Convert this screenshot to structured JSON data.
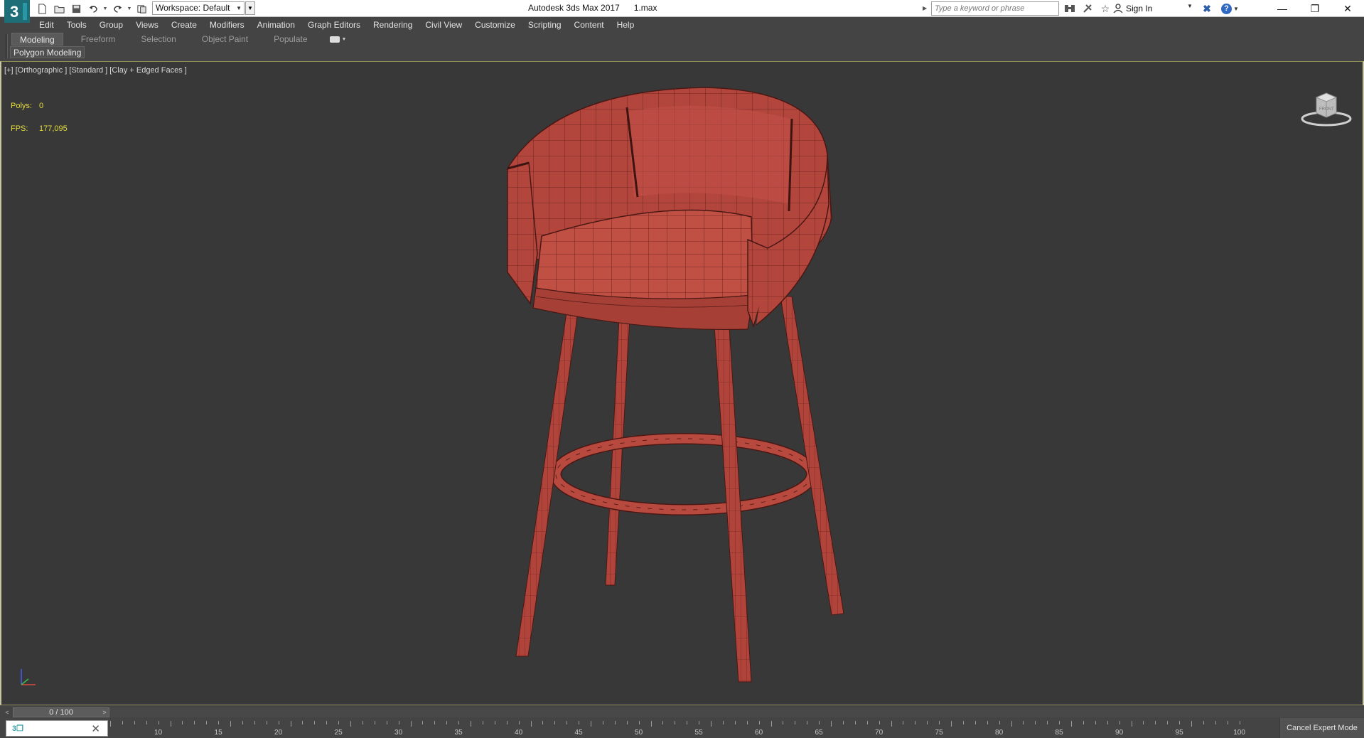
{
  "app": {
    "title": "Autodesk 3ds Max 2017",
    "file": "1.max",
    "workspace": "Workspace: Default",
    "search_placeholder": "Type a keyword or phrase",
    "sign_in": "Sign In"
  },
  "menus": [
    "Edit",
    "Tools",
    "Group",
    "Views",
    "Create",
    "Modifiers",
    "Animation",
    "Graph Editors",
    "Rendering",
    "Civil View",
    "Customize",
    "Scripting",
    "Content",
    "Help"
  ],
  "ribbon": {
    "tabs": [
      "Modeling",
      "Freeform",
      "Selection",
      "Object Paint",
      "Populate"
    ],
    "active_tab": "Modeling",
    "panel": "Polygon Modeling"
  },
  "viewport": {
    "label": "[+] [Orthographic ] [Standard ] [Clay + Edged Faces ]",
    "stats": {
      "polys_label": "Polys:",
      "polys_value": "0",
      "fps_label": "FPS:",
      "fps_value": "177,095"
    },
    "viewcube_face": "FRONT",
    "object_color": "#b8493e",
    "stat_color": "#e6de3c"
  },
  "timeline": {
    "frame": "0 / 100",
    "ticks": [
      "10",
      "15",
      "20",
      "25",
      "30",
      "35",
      "40",
      "45",
      "50",
      "55",
      "60",
      "65",
      "70",
      "75",
      "80",
      "85",
      "90",
      "95",
      "100"
    ]
  },
  "status": {
    "cancel_expert": "Cancel Expert Mode"
  },
  "icons": [
    "new-file-icon",
    "open-file-icon",
    "save-icon",
    "undo-icon",
    "redo-icon",
    "project-folder-icon",
    "binoculars-icon",
    "communication-center-icon",
    "favorites-star-icon",
    "user-icon",
    "exchange-apps-icon",
    "help-icon",
    "minimize-icon",
    "restore-icon",
    "close-icon"
  ]
}
